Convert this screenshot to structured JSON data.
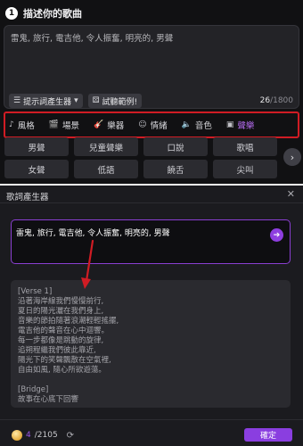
{
  "step": {
    "number": "1",
    "title": "描述你的歌曲"
  },
  "description": {
    "text": "雷鬼, 旅行, 電吉他, 令人振奮, 明亮的, 男聲",
    "hint_button": "提示詞產生器",
    "sample_button": "試聽範例!",
    "count_used": "26",
    "count_max": "/1800"
  },
  "categories": [
    {
      "label": "風格",
      "icon": "style-icon"
    },
    {
      "label": "場景",
      "icon": "scene-icon"
    },
    {
      "label": "樂器",
      "icon": "guitar-icon"
    },
    {
      "label": "情緒",
      "icon": "emoji-icon"
    },
    {
      "label": "音色",
      "icon": "speaker-icon"
    },
    {
      "label": "聲樂",
      "icon": "vocal-icon"
    }
  ],
  "tags_row1": [
    "男聲",
    "兒童聲樂",
    "口說",
    "歌唱"
  ],
  "tags_row2": [
    "女聲",
    "低語",
    "饒舌",
    "尖叫"
  ],
  "panel": {
    "title": "歌詞產生器",
    "prompt": "雷鬼, 旅行, 電吉他, 令人振奮, 明亮的, 男聲",
    "lyrics": "[Verse 1]\n沿著海岸線我們慢慢前行,\n夏日的陽光灑在我們身上,\n音樂的節拍隨著浪潮輕輕搖擺,\n電吉他的聲音在心中迴響。\n每一步都像是跳動的旋律,\n追朔程繼我們彼此靠近,\n陽光下的笑聲飄散在空氣裡,\n自由如風, 隨心所欲遊蕩。\n\n[Bridge]\n故事在心底下回響",
    "credits_used": "4",
    "credits_total": "/2105",
    "confirm": "確定"
  },
  "colors": {
    "accent": "#8e3ee0",
    "highlight": "#d01c24"
  }
}
